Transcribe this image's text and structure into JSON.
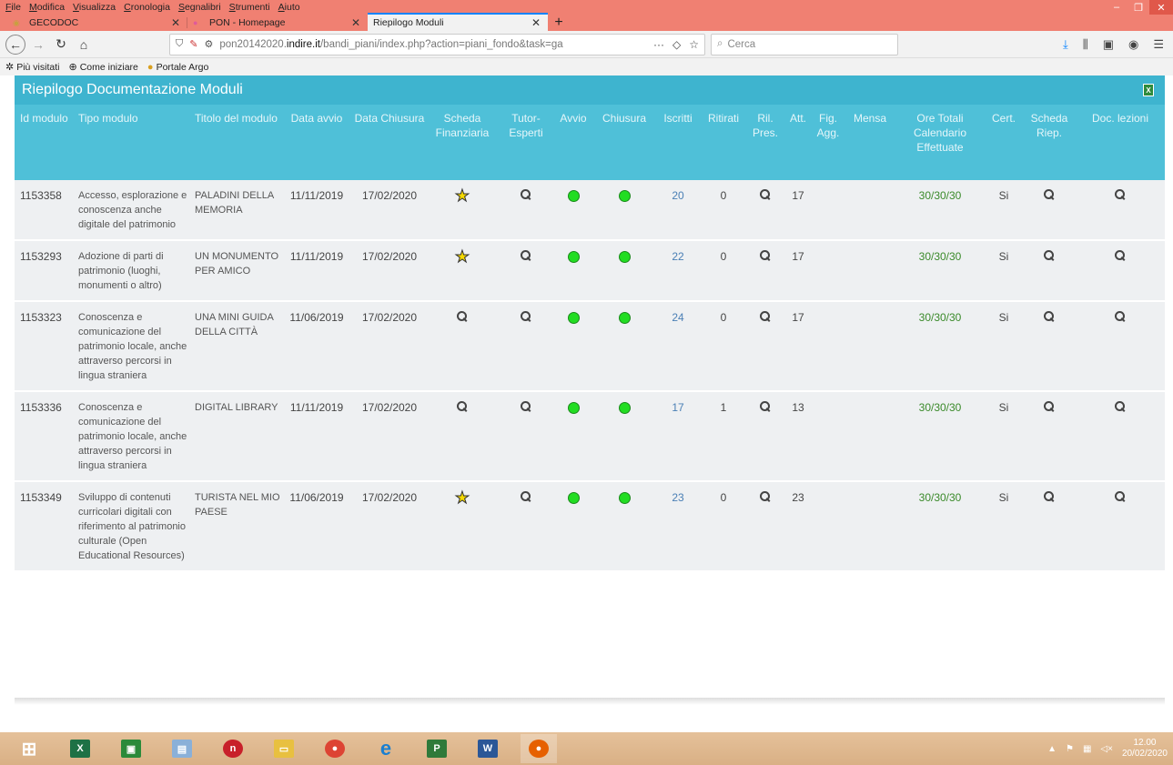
{
  "menu": [
    "File",
    "Modifica",
    "Visualizza",
    "Cronologia",
    "Segnalibri",
    "Strumenti",
    "Aiuto"
  ],
  "tabs": [
    {
      "label": "GECODOC",
      "active": false
    },
    {
      "label": "PON - Homepage",
      "active": false
    },
    {
      "label": "Riepilogo Moduli",
      "active": true
    }
  ],
  "url": {
    "prefix": "pon20142020.",
    "host": "indire.it",
    "path": "/bandi_piani/index.php?action=piani_fondo&task=ga"
  },
  "search_placeholder": "Cerca",
  "bookmarks": [
    "Più visitati",
    "Come iniziare",
    "Portale Argo"
  ],
  "page": {
    "title": "Riepilogo Documentazione Moduli",
    "headers": [
      "Id modulo",
      "Tipo modulo",
      "Titolo del modulo",
      "Data avvio",
      "Data Chiusura",
      "Scheda Finanziaria",
      "Tutor-Esperti",
      "Avvio",
      "Chiusura",
      "Iscritti",
      "Ritirati",
      "Ril. Pres.",
      "Att.",
      "Fig. Agg.",
      "Mensa",
      "Ore Totali Calendario Effettuate",
      "Cert.",
      "Scheda Riep.",
      "Doc. lezioni"
    ],
    "rows": [
      {
        "id": "1153358",
        "tipo": "Accesso, esplorazione e conoscenza anche digitale del patrimonio",
        "titolo": "PALADINI DELLA MEMORIA",
        "avvio": "11/11/2019",
        "chiusura": "17/02/2020",
        "scheda": "star",
        "iscritti": "20",
        "ritirati": "0",
        "att": "17",
        "ore": "30/30/30",
        "cert": "Si"
      },
      {
        "id": "1153293",
        "tipo": "Adozione di parti di patrimonio (luoghi, monumenti o altro)",
        "titolo": "UN MONUMENTO PER AMICO",
        "avvio": "11/11/2019",
        "chiusura": "17/02/2020",
        "scheda": "star",
        "iscritti": "22",
        "ritirati": "0",
        "att": "17",
        "ore": "30/30/30",
        "cert": "Si"
      },
      {
        "id": "1153323",
        "tipo": "Conoscenza e comunicazione del patrimonio locale, anche attraverso percorsi in lingua straniera",
        "titolo": "UNA MINI GUIDA DELLA CITTÀ",
        "avvio": "11/06/2019",
        "chiusura": "17/02/2020",
        "scheda": "search",
        "iscritti": "24",
        "ritirati": "0",
        "att": "17",
        "ore": "30/30/30",
        "cert": "Si"
      },
      {
        "id": "1153336",
        "tipo": "Conoscenza e comunicazione del patrimonio locale, anche attraverso percorsi in lingua straniera",
        "titolo": "DIGITAL LIBRARY",
        "avvio": "11/11/2019",
        "chiusura": "17/02/2020",
        "scheda": "search",
        "iscritti": "17",
        "ritirati": "1",
        "att": "13",
        "ore": "30/30/30",
        "cert": "Si"
      },
      {
        "id": "1153349",
        "tipo": "Sviluppo di contenuti curricolari digitali con riferimento al patrimonio culturale (Open Educational Resources)",
        "titolo": "TURISTA NEL MIO PAESE",
        "avvio": "11/06/2019",
        "chiusura": "17/02/2020",
        "scheda": "star",
        "iscritti": "23",
        "ritirati": "0",
        "att": "23",
        "ore": "30/30/30",
        "cert": "Si"
      }
    ]
  },
  "clock": {
    "time": "12.00",
    "date": "20/02/2020"
  },
  "colors": {
    "header": "#4fc0d8",
    "row": "#eef0f2",
    "chrome": "#f08072",
    "status_dot": "#22dd22"
  }
}
